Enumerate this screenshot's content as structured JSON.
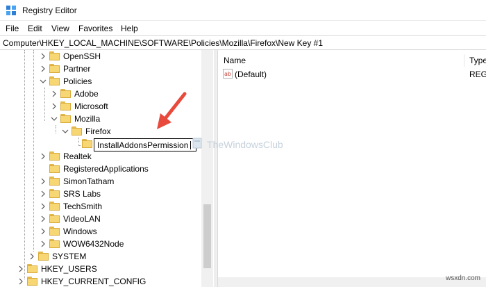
{
  "window": {
    "title": "Registry Editor"
  },
  "menu": [
    "File",
    "Edit",
    "View",
    "Favorites",
    "Help"
  ],
  "address": "Computer\\HKEY_LOCAL_MACHINE\\SOFTWARE\\Policies\\Mozilla\\Firefox\\New Key #1",
  "tree": {
    "items": [
      "OpenSSH",
      "Partner",
      "Policies",
      "Adobe",
      "Microsoft",
      "Mozilla",
      "Firefox",
      "Realtek",
      "RegisteredApplications",
      "SimonTatham",
      "SRS Labs",
      "TechSmith",
      "VideoLAN",
      "Windows",
      "WOW6432Node",
      "SYSTEM",
      "HKEY_USERS",
      "HKEY_CURRENT_CONFIG"
    ],
    "editing_value": "InstallAddonsPermission"
  },
  "list": {
    "columns": [
      "Name",
      "Type"
    ],
    "rows": [
      {
        "name": "(Default)",
        "type": "REG_"
      }
    ]
  },
  "watermark": "TheWindowsClub",
  "footer": "wsxdn.com",
  "colors": {
    "folder": "#f7d774",
    "arrow": "#e84a3c"
  }
}
